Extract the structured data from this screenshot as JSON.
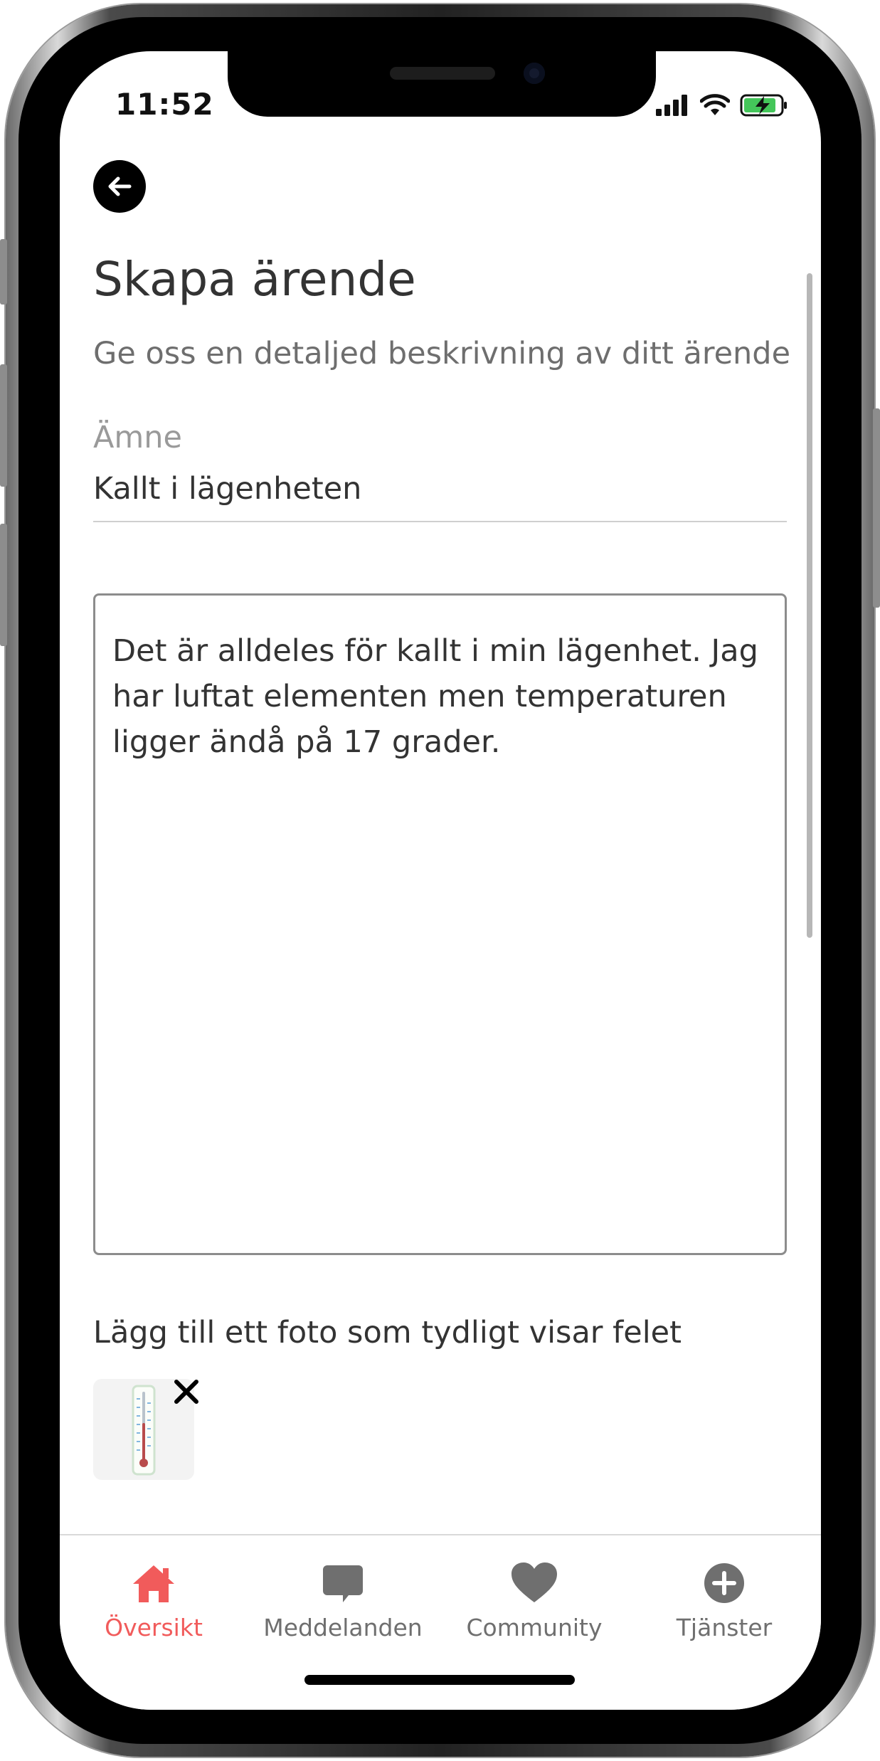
{
  "status_bar": {
    "time": "11:52"
  },
  "header": {
    "title": "Skapa ärende",
    "subtitle": "Ge oss en detaljed beskrivning av ditt ärende"
  },
  "form": {
    "subject_label": "Ämne",
    "subject_value": "Kallt i lägenheten",
    "description_value": "Det är alldeles för kallt i min lägenhet. Jag har luftat elementen men temperaturen ligger ändå på 17 grader.",
    "photo_label": "Lägg till ett foto som tydligt visar felet"
  },
  "tabs": [
    {
      "label": "Översikt",
      "icon": "home-icon",
      "active": true
    },
    {
      "label": "Meddelanden",
      "icon": "chat-icon",
      "active": false
    },
    {
      "label": "Community",
      "icon": "heart-icon",
      "active": false
    },
    {
      "label": "Tjänster",
      "icon": "plus-circle-icon",
      "active": false
    }
  ],
  "colors": {
    "accent": "#f15b5b",
    "text": "#333333",
    "muted": "#9a9a9a",
    "icon": "#6f6f6f"
  }
}
